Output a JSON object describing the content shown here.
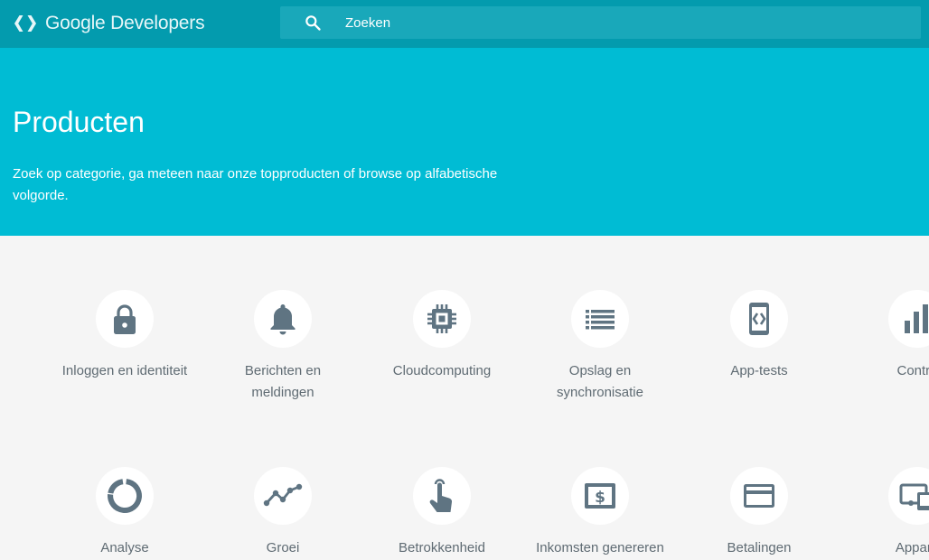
{
  "header": {
    "logo_text": "Google Developers",
    "search": {
      "placeholder": "Zoeken"
    }
  },
  "hero": {
    "title": "Producten",
    "description": "Zoek op categorie, ga meteen naar onze topproducten of browse op alfabetische volgorde."
  },
  "colors": {
    "topbar": "#039bae",
    "hero": "#00bcd4",
    "icon": "#5f7482",
    "background": "#f5f5f5"
  },
  "categories": {
    "row1": [
      {
        "label": "Inloggen en identiteit",
        "icon": "lock-icon"
      },
      {
        "label": "Berichten en meldingen",
        "icon": "bell-icon"
      },
      {
        "label": "Cloudcomputing",
        "icon": "chip-icon"
      },
      {
        "label": "Opslag en synchronisatie",
        "icon": "list-icon"
      },
      {
        "label": "App-tests",
        "icon": "phone-code-icon"
      },
      {
        "label": "Contro",
        "icon": "bar-chart-icon"
      }
    ],
    "row2": [
      {
        "label": "Analyse",
        "icon": "donut-icon"
      },
      {
        "label": "Groei",
        "icon": "line-chart-icon"
      },
      {
        "label": "Betrokkenheid",
        "icon": "touch-icon"
      },
      {
        "label": "Inkomsten genereren",
        "icon": "dollar-icon"
      },
      {
        "label": "Betalingen",
        "icon": "credit-card-icon"
      },
      {
        "label": "Appara",
        "icon": "devices-icon"
      }
    ]
  }
}
